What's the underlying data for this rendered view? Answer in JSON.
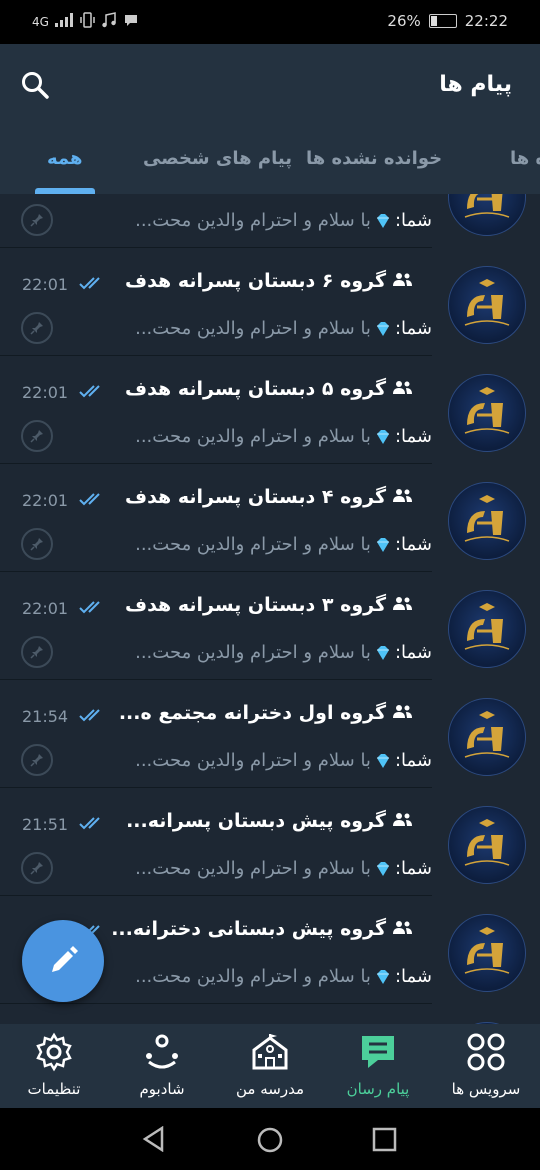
{
  "status": {
    "network": "4G",
    "battery": "26%",
    "time": "22:22"
  },
  "header": {
    "title": "پیام ها"
  },
  "tabs": [
    {
      "label": "همه",
      "active": true
    },
    {
      "label": "پیام های شخصی",
      "active": false
    },
    {
      "label": "خوانده نشده ها",
      "active": false
    },
    {
      "label": "گروه ها",
      "active": false
    }
  ],
  "chats": [
    {
      "name": "",
      "time": "",
      "you": "شما:",
      "preview": "با سلام و احترام  والدین محت..."
    },
    {
      "name": "گروه ۶ دبستان پسرانه هدف",
      "time": "22:01",
      "you": "شما:",
      "preview": "با سلام و احترام  والدین محت..."
    },
    {
      "name": "گروه ۵ دبستان پسرانه هدف",
      "time": "22:01",
      "you": "شما:",
      "preview": "با سلام و احترام  والدین محت..."
    },
    {
      "name": "گروه ۴ دبستان پسرانه هدف",
      "time": "22:01",
      "you": "شما:",
      "preview": "با سلام و احترام  والدین محت..."
    },
    {
      "name": "گروه ۳ دبستان پسرانه هدف",
      "time": "22:01",
      "you": "شما:",
      "preview": "با سلام و احترام  والدین محت..."
    },
    {
      "name": "گروه اول دخترانه مجتمع ه...",
      "time": "21:54",
      "you": "شما:",
      "preview": "با سلام و احترام  والدین محت..."
    },
    {
      "name": "گروه پیش دبستان پسرانه...",
      "time": "21:51",
      "you": "شما:",
      "preview": "با سلام و احترام  والدین محت..."
    },
    {
      "name": "گروه پیش دبستانی دخترانه...",
      "time": "",
      "you": "شما:",
      "preview": "با سلام و احترام  والدین محت..."
    }
  ],
  "bottom_nav": [
    {
      "label": "سرویس ها",
      "icon": "grid-icon",
      "active": false
    },
    {
      "label": "پیام رسان",
      "icon": "message-icon",
      "active": true
    },
    {
      "label": "مدرسه من",
      "icon": "school-icon",
      "active": false
    },
    {
      "label": "شادبوم",
      "icon": "shadboom-icon",
      "active": false
    },
    {
      "label": "تنظیمات",
      "icon": "gear-icon",
      "active": false
    }
  ],
  "colors": {
    "accent": "#5fb0f0",
    "active_nav": "#4ccf9a",
    "fab": "#4a94e0",
    "background": "#1d2733",
    "bar": "#243240"
  }
}
